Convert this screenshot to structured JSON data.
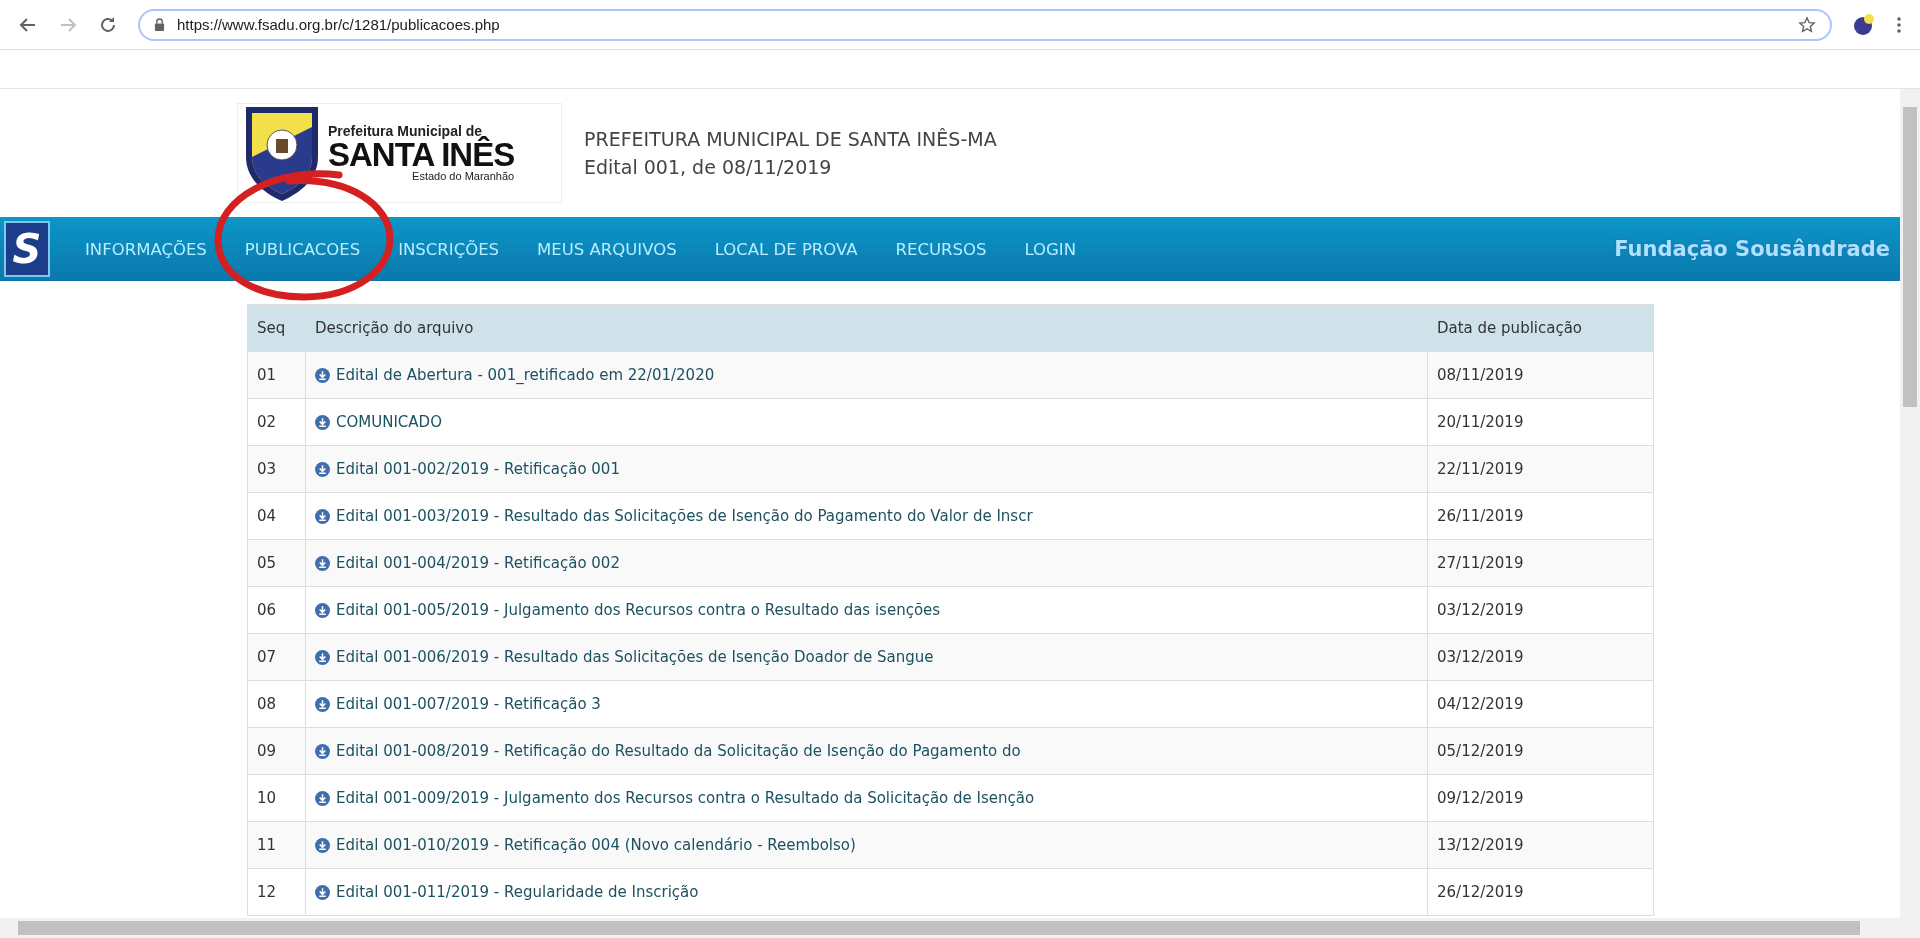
{
  "browser": {
    "url": "https://www.fsadu.org.br/c/1281/publicacoes.php",
    "forward_disabled": true
  },
  "header": {
    "logo": {
      "line1": "Prefeitura Municipal de",
      "line2": "SANTA INÊS",
      "line3": "Estado do Maranhão"
    },
    "title": "PREFEITURA MUNICIPAL DE SANTA INÊS-MA",
    "subtitle": "Edital 001, de 08/11/2019"
  },
  "nav": {
    "logo_letter": "S",
    "items": [
      {
        "label": "INFORMAÇÕES"
      },
      {
        "label": "PUBLICACOES"
      },
      {
        "label": "INSCRIÇÕES"
      },
      {
        "label": "MEUS ARQUIVOS"
      },
      {
        "label": "LOCAL DE PROVA"
      },
      {
        "label": "RECURSOS"
      },
      {
        "label": "LOGIN"
      }
    ],
    "brand": "Fundação Sousândrade"
  },
  "table": {
    "columns": [
      "Seq",
      "Descrição do arquivo",
      "Data de publicação"
    ],
    "rows": [
      {
        "seq": "01",
        "description": "Edital de Abertura - 001_retificado em 22/01/2020",
        "date": "08/11/2019"
      },
      {
        "seq": "02",
        "description": "COMUNICADO",
        "date": "20/11/2019"
      },
      {
        "seq": "03",
        "description": "Edital 001-002/2019 - Retificação 001",
        "date": "22/11/2019"
      },
      {
        "seq": "04",
        "description": "Edital 001-003/2019 - Resultado das Solicitações de Isenção do Pagamento do Valor de Inscr",
        "date": "26/11/2019"
      },
      {
        "seq": "05",
        "description": "Edital 001-004/2019 - Retificação 002",
        "date": "27/11/2019"
      },
      {
        "seq": "06",
        "description": "Edital 001-005/2019 - Julgamento dos Recursos contra o Resultado das isenções",
        "date": "03/12/2019"
      },
      {
        "seq": "07",
        "description": "Edital 001-006/2019 - Resultado das Solicitações de Isenção Doador de Sangue",
        "date": "03/12/2019"
      },
      {
        "seq": "08",
        "description": "Edital 001-007/2019 - Retificação 3",
        "date": "04/12/2019"
      },
      {
        "seq": "09",
        "description": "Edital 001-008/2019 - Retificação do Resultado da Solicitação de Isenção do Pagamento do",
        "date": "05/12/2019"
      },
      {
        "seq": "10",
        "description": "Edital 001-009/2019 - Julgamento dos Recursos contra o Resultado da Solicitação de Isenção",
        "date": "09/12/2019"
      },
      {
        "seq": "11",
        "description": "Edital 001-010/2019 - Retificação 004 (Novo calendário - Reembolso)",
        "date": "13/12/2019"
      },
      {
        "seq": "12",
        "description": "Edital 001-011/2019 - Regularidade de Inscrição",
        "date": "26/12/2019"
      }
    ]
  }
}
